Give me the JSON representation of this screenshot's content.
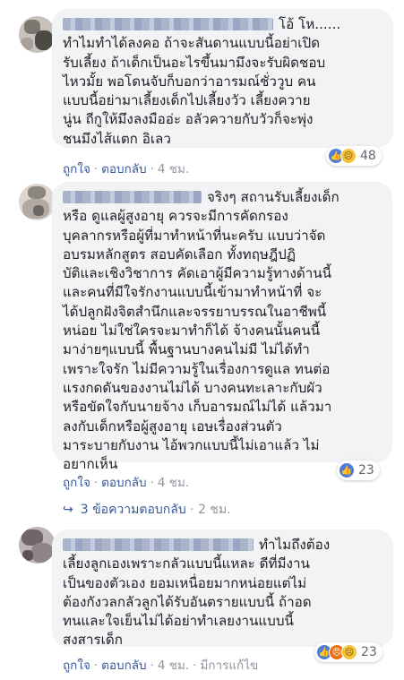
{
  "comments": [
    {
      "name_suffix": "โอ้ โห......",
      "text": "ทำไมทำได้ลงคอ ถ้าจะสันดานแบบนี้อย่าเปิด\nรับเลี้ยง ถ้าเด็กเป็นอะไรขึ้นมามึงจะรับผิดชอบ\nไหวมั้ย พอโดนจับก็บอกว่าอารมณ์ชั่ววูบ คน\nแบบนี้อย่ามาเลี้ยงเด็กไปเลี้ยงวัว เลี้ยงควาย\nนู่น ถีกูให้มึงลงมืออ่ะ อลัวควายกับวัวก็จะพุ่ง\nชนมึงไส้แตก อิเลว",
      "reactions": {
        "icons": [
          "like-icon",
          "sad-icon"
        ],
        "count": "48"
      },
      "actions": {
        "like": "ถูกใจ",
        "reply": "ตอบกลับ",
        "time": "4 ชม."
      }
    },
    {
      "name_suffix": "จริงๆ สถานรับเลี้ยงเด็ก",
      "text": "หรือ ดูแลผู้สูงอายุ ควรจะมีการคัดกรอง\nบุคลากรหรือผู้ที่มาทำหน้าที่นะครับ แบบว่าจัด\nอบรมหลักสูตร สอบคัดเลือก ทั้งทฤษฎีปฏิ\nบัติและเชิงวิชาการ คัดเอาผู้มีความรู้ทางด้านนี้\nและคนที่มีใจรักงานแบบนี้เข้ามาทำหน้าที่ จะ\nได้ปลูกฝังจิตสำนึกและจรรยาบรรณในอาชีพนี้\nหน่อย ไม่ใช่ใครจะมาทำก็ได้ จ้างคนนั้นคนนี้\nมาง่ายๆแบบนี้ พื้นฐานบางคนไม่มี ไม่ได้ทำ\nเพราะใจรัก ไม่มีความรู้ในเรื่องการดูแล ทนต่อ\nแรงกดดันของงานไม่ได้ บางคนทะเลาะกับผัว\nหรือขัดใจกับนายจ้าง เก็บอารมณ์ไม่ได้ แล้วมา\nลงกับเด็กหรือผู้สูงอายุ เอษเรื่องส่วนตัว\nมาระบายกับงาน ไอ้พวกแบบนี้ไม่เอาแล้ว ไม่\nอยากเห็น",
      "reactions": {
        "icons": [
          "like-icon"
        ],
        "count": "23"
      },
      "actions": {
        "like": "ถูกใจ",
        "reply": "ตอบกลับ",
        "time": "4 ชม."
      },
      "replies": {
        "label": "3 ข้อความตอบกลับ",
        "time": "2 ชม."
      }
    },
    {
      "name_suffix": "ทำไมถึงต้อง",
      "text": "เลี้ยงลูกเองเพราะกลัวแบบนี้แหละ ดีที่มีงาน\nเป็นของตัวเอง ยอมเหนื่อยมากหน่อยแต่ไม่\nต้องกังวลกลัวลูกได้รับอันตรายแบบนี้ ถ้าอด\nทนและใจเย็นไม่ได้อย่าทำเลยงานแบบนี้\nสงสารเด็ก",
      "reactions": {
        "icons": [
          "like-icon",
          "angry-icon",
          "sad-icon"
        ],
        "count": "23"
      },
      "actions": {
        "like": "ถูกใจ",
        "reply": "ตอบกลับ",
        "time": "4 ชม.",
        "edited": "มีการแก้ไข"
      }
    }
  ],
  "colors": {
    "bubble": "#f2f3f5",
    "link": "#385898",
    "meta": "#90949c",
    "like": "#4e7dd8"
  }
}
